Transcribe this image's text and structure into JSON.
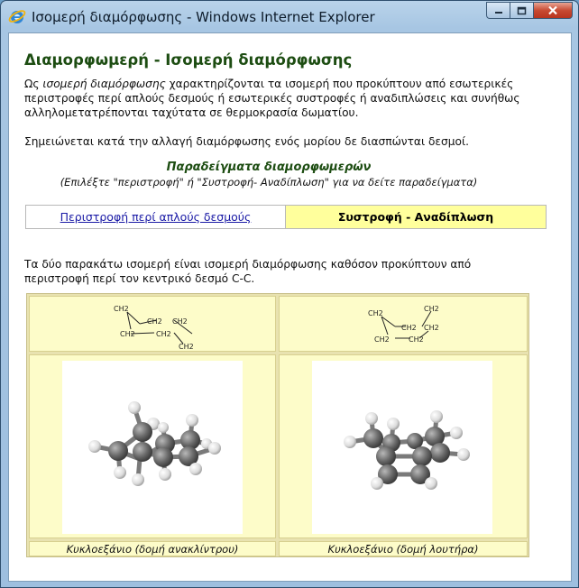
{
  "window": {
    "title": "Ισομερή διαμόρφωσης - Windows Internet Explorer"
  },
  "page": {
    "heading": "Διαμορφωμερή - Ισομερή διαμόρφωσης",
    "intro_em": "ισομερή διαμόρφωσης",
    "intro_prefix": "Ως ",
    "intro_rest": " χαρακτηρίζονται τα ισομερή που προκύπτουν από εσωτερικές περιστροφές περί απλούς δεσμούς ή εσωτερικές συστροφές ή αναδιπλώσεις και συνήθως αλληλομετατρέπονται ταχύτατα σε θερμοκρασία δωματίου.",
    "note": "Σημειώνεται κατά την αλλαγή διαμόρφωσης ενός μορίου δε διασπώνται δεσμοί.",
    "examples_title": "Παραδείγματα διαμορφωμερών",
    "examples_subtitle": "(Επιλέξτε \"περιστροφή\" ή \"Συστροφή- Αναδίπλωση\" για να δείτε παραδείγματα)",
    "tabs": [
      {
        "label": "Περιστροφή περί απλούς δεσμούς",
        "active": false
      },
      {
        "label": "Συστροφή - Αναδίπλωση",
        "active": true
      }
    ],
    "description": "Τα δύο παρακάτω ισομερή είναι ισομερή διαμόρφωσης καθόσον προκύπτουν από περιστροφή περί τον κεντρικό δεσμό C-C.",
    "formula_label": "CH2",
    "structures": [
      {
        "caption": "Κυκλοεξάνιο (δομή ανακλίντρου)"
      },
      {
        "caption": "Κυκλοεξάνιο (δομή λουτήρα)"
      }
    ]
  },
  "colors": {
    "heading": "#1d4d12",
    "cell_bg": "#fdfcc9",
    "active_tab": "#ffff9c",
    "link": "#1a1aa6"
  }
}
